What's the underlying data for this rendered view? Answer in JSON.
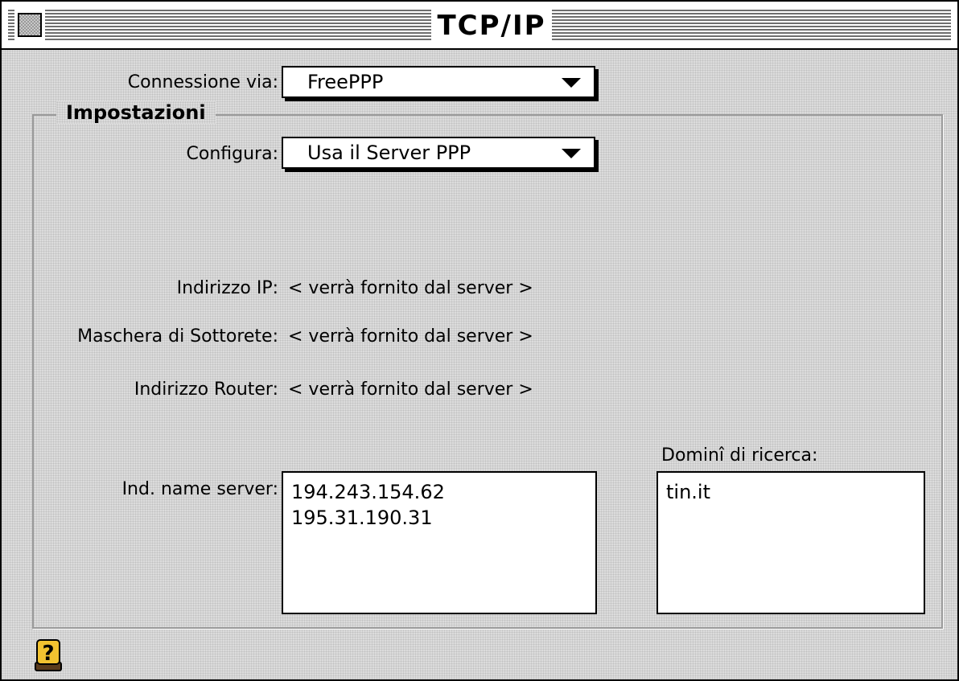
{
  "window": {
    "title": "TCP/IP"
  },
  "connection": {
    "label": "Connessione via:",
    "value": "FreePPP"
  },
  "settings": {
    "group_title": "Impostazioni",
    "configure_label": "Configura:",
    "configure_value": "Usa il Server PPP",
    "ip_label": "Indirizzo IP:",
    "ip_value": "< verrà fornito dal server >",
    "subnet_label": "Maschera di Sottorete:",
    "subnet_value": "< verrà fornito dal server >",
    "router_label": "Indirizzo Router:",
    "router_value": "< verrà fornito dal server >",
    "dns_label": "Ind. name server:",
    "dns_servers": [
      "194.243.154.62",
      "195.31.190.31"
    ],
    "search_domains_label": "Dominî di ricerca:",
    "search_domains": [
      "tin.it"
    ]
  },
  "icons": {
    "close": "close-box-icon",
    "help": "help-question-icon",
    "popup_arrow": "triangle-down-icon"
  }
}
